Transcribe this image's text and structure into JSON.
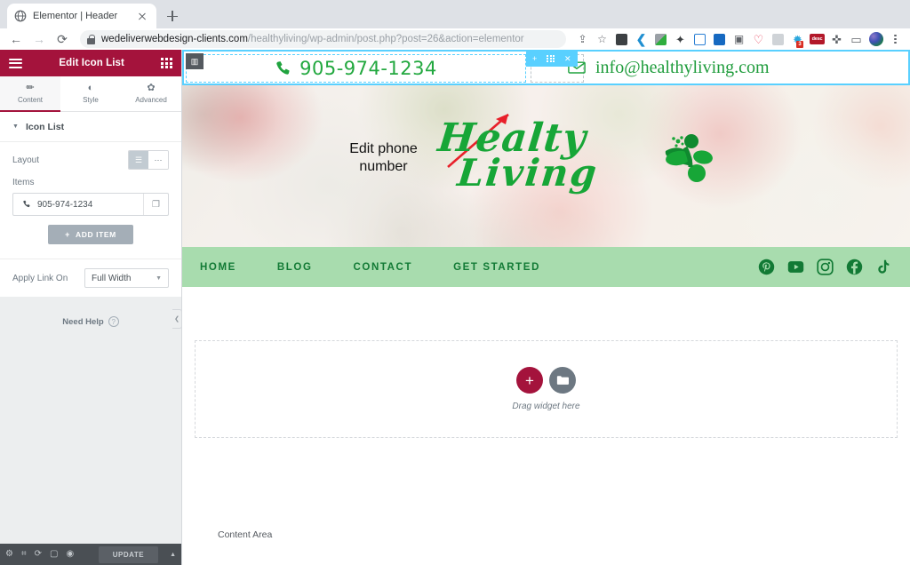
{
  "browser": {
    "tab": {
      "title": "Elementor | Header",
      "favicon_icon": "globe-icon",
      "close_icon": "close-icon"
    },
    "new_tab_icon": "plus-icon",
    "nav": {
      "back_icon": "arrow-left-icon",
      "forward_icon": "arrow-right-icon",
      "reload_icon": "reload-icon"
    },
    "omnibox": {
      "lock_icon": "lock-icon",
      "host": "wedeliverwebdesign-clients.com",
      "path": "/healthyliving/wp-admin/post.php?post=26&action=elementor",
      "full_url": "wedeliverwebdesign-clients.com/healthyliving/wp-admin/post.php?post=26&action=elementor"
    },
    "toolbar_icons": [
      {
        "name": "share-icon",
        "glyph": "⇪"
      },
      {
        "name": "bookmark-star-icon",
        "glyph": "☆"
      },
      {
        "name": "keyboard-extension-icon",
        "glyph": "▦",
        "color": "#3c4043"
      },
      {
        "name": "clarity-extension-icon",
        "glyph": "❮",
        "color": "#1f8fd1"
      },
      {
        "name": "eyedropper-extension-icon",
        "glyph": "✎",
        "color": "#2fae3e"
      },
      {
        "name": "wrench-extension-icon",
        "glyph": "✦",
        "color": "#3c4043"
      },
      {
        "name": "page-extension-icon",
        "glyph": "▯",
        "color": "#2a7fd4"
      },
      {
        "name": "layout-extension-icon",
        "glyph": "▣",
        "color": "#1669c1"
      },
      {
        "name": "camera-extension-icon",
        "glyph": "▣",
        "color": "#5f6368"
      },
      {
        "name": "loom-extension-icon",
        "glyph": "◡",
        "color": "#e8455e"
      },
      {
        "name": "grammar-extension-icon",
        "glyph": "▨",
        "color": "#b9bcc0"
      },
      {
        "name": "sparkle-extension-icon",
        "glyph": "✹",
        "color": "#2aa7dd",
        "badge": "3"
      },
      {
        "name": "desc-extension-icon",
        "label": "desc",
        "color": "#b3182a"
      },
      {
        "name": "extensions-puzzle-icon",
        "glyph": "✜"
      },
      {
        "name": "sidepanel-icon",
        "glyph": "▭"
      },
      {
        "name": "profile-avatar",
        "glyph": ""
      },
      {
        "name": "chrome-menu-icon",
        "glyph": "⋮"
      }
    ]
  },
  "panel": {
    "header": {
      "menu_icon": "hamburger-icon",
      "title": "Edit Icon List",
      "apps_icon": "grid-icon"
    },
    "tabs": [
      {
        "label": "Content",
        "icon": "pencil-icon",
        "glyph": "✏",
        "active": true
      },
      {
        "label": "Style",
        "icon": "contrast-icon",
        "glyph": "◐",
        "active": false
      },
      {
        "label": "Advanced",
        "icon": "gear-icon",
        "glyph": "✿",
        "active": false
      }
    ],
    "section": {
      "title": "Icon List",
      "caret": "▼"
    },
    "layout": {
      "label": "Layout",
      "options": [
        {
          "name": "list-layout",
          "glyph": "☰",
          "active": true
        },
        {
          "name": "inline-layout",
          "glyph": "⋯",
          "active": false
        }
      ]
    },
    "items": {
      "label": "Items",
      "rows": [
        {
          "icon": "phone-icon",
          "glyph": "📞",
          "text": "905-974-1234",
          "duplicate_icon": "duplicate-icon",
          "duplicate_glyph": "❐"
        }
      ],
      "add_button": {
        "label": "ADD ITEM",
        "plus": "+"
      }
    },
    "apply_link": {
      "label": "Apply Link On",
      "value": "Full Width",
      "caret": "▼"
    },
    "need_help": {
      "label": "Need Help",
      "icon": "question-mark-icon",
      "glyph": "?"
    },
    "collapse_handle": {
      "icon": "chevron-left-icon",
      "glyph": "❮"
    },
    "footer": {
      "icons": [
        {
          "name": "settings-icon",
          "glyph": "⚙"
        },
        {
          "name": "navigator-icon",
          "glyph": "⌗"
        },
        {
          "name": "history-icon",
          "glyph": "⟳"
        },
        {
          "name": "responsive-mode-icon",
          "glyph": "▢"
        },
        {
          "name": "preview-changes-icon",
          "glyph": "👁"
        }
      ],
      "update_label": "UPDATE",
      "update_caret": "▲"
    }
  },
  "preview": {
    "topbar": {
      "column_handle_icon": "column-handle-icon",
      "column_handle_glyph": "▥",
      "phone": {
        "icon": "phone-icon",
        "glyph": "📞",
        "text": "905-974-1234",
        "color": "#22a83f"
      },
      "email": {
        "icon": "envelope-icon",
        "glyph": "✉",
        "text": "info@healthyliving.com",
        "color": "#1f9c3c"
      },
      "widget_toolbar": {
        "add_icon": "plus-icon",
        "add_glyph": "+",
        "drag_icon": "drag-handle-icon",
        "close_icon": "close-icon",
        "close_glyph": "✕",
        "color": "#59d0ff"
      }
    },
    "hero": {
      "annotation": {
        "line1": "Edit phone",
        "line2": "number",
        "arrow_icon": "red-arrow-icon",
        "arrow_color": "#e8202a"
      },
      "logo": {
        "line1": "Healty",
        "line2": "Living",
        "figure_icon": "running-person-icon",
        "color": "#17a637"
      }
    },
    "nav": {
      "background": "#a8dcae",
      "text_color": "#127a35",
      "links": [
        "HOME",
        "BLOG",
        "CONTACT",
        "GET STARTED"
      ],
      "social": [
        {
          "name": "pinterest-icon"
        },
        {
          "name": "youtube-icon"
        },
        {
          "name": "instagram-icon"
        },
        {
          "name": "facebook-icon"
        },
        {
          "name": "tiktok-icon"
        }
      ]
    },
    "body": {
      "drop_zone": {
        "add_section_icon": "plus-icon",
        "add_section_glyph": "+",
        "template_library_icon": "folder-icon",
        "template_library_glyph": "🗀",
        "hint": "Drag widget here"
      },
      "content_area_label": "Content Area"
    }
  }
}
